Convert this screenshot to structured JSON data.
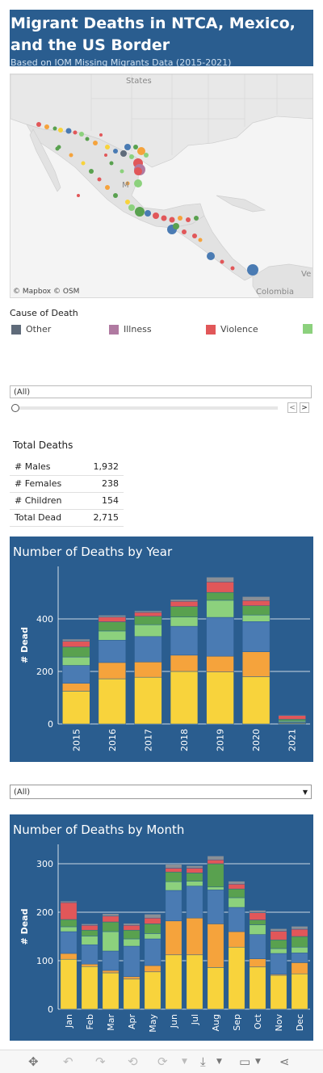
{
  "header": {
    "title": "Migrant Deaths in NTCA, Mexico, and the US Border",
    "subtitle": "Based on IOM Missing Migrants Data (2015-2021)"
  },
  "map": {
    "labels": {
      "states": "States",
      "colombia": "Colombia",
      "mexico_partial": "M",
      "ve_partial": "Ve"
    },
    "credit_mapbox": "© Mapbox",
    "credit_osm": "© OSM"
  },
  "legend": {
    "title": "Cause of Death",
    "items": [
      {
        "label": "Other",
        "color": "#5f6b7a"
      },
      {
        "label": "Illness",
        "color": "#b07aa1"
      },
      {
        "label": "Violence",
        "color": "#e15759"
      },
      {
        "label": "",
        "color": "#8cd17d"
      }
    ]
  },
  "year_filter": {
    "value": "(All)",
    "prev": "<",
    "next": ">"
  },
  "totals": {
    "title": "Total Deaths",
    "rows": [
      {
        "label": "# Males",
        "value": "1,932"
      },
      {
        "label": "# Females",
        "value": "238"
      },
      {
        "label": "# Children",
        "value": "154"
      },
      {
        "label": "Total Dead",
        "value": "2,715"
      }
    ]
  },
  "month_filter": {
    "value": "(All)"
  },
  "colors": {
    "panel_bg": "#2a5d8f",
    "yellow": "#f8d33c",
    "orange": "#f5a33c",
    "blue": "#4a7bb3",
    "lightgreen": "#8cd17d",
    "green": "#59a14f",
    "red": "#e15759",
    "grey": "#8a8f96"
  },
  "chart_data": [
    {
      "type": "bar",
      "stacked": true,
      "title": "Number of Deaths by Year",
      "ylabel": "# Dead",
      "ylim": [
        0,
        600
      ],
      "yticks": [
        0,
        200,
        400
      ],
      "categories": [
        "2015",
        "2016",
        "2017",
        "2018",
        "2019",
        "2020",
        "2021"
      ],
      "series": [
        {
          "color": "#f8d33c",
          "values": [
            125,
            172,
            178,
            200,
            198,
            180,
            3
          ]
        },
        {
          "color": "#f5a33c",
          "values": [
            30,
            62,
            58,
            62,
            60,
            95,
            2
          ]
        },
        {
          "color": "#4a7bb3",
          "values": [
            68,
            85,
            97,
            110,
            148,
            115,
            2
          ]
        },
        {
          "color": "#8cd17d",
          "values": [
            32,
            35,
            45,
            35,
            65,
            25,
            5
          ]
        },
        {
          "color": "#59a14f",
          "values": [
            38,
            35,
            32,
            40,
            30,
            35,
            6
          ]
        },
        {
          "color": "#e15759",
          "values": [
            22,
            18,
            15,
            20,
            40,
            20,
            14
          ]
        },
        {
          "color": "#8a8f96",
          "values": [
            8,
            7,
            6,
            7,
            18,
            15,
            3
          ]
        }
      ]
    },
    {
      "type": "bar",
      "stacked": true,
      "title": "Number of Deaths by Month",
      "ylabel": "# Dead",
      "ylim": [
        0,
        340
      ],
      "yticks": [
        0,
        100,
        200,
        300
      ],
      "categories": [
        "Jan",
        "Feb",
        "Mar",
        "Apr",
        "May",
        "Jun",
        "Jul",
        "Aug",
        "Sep",
        "Oct",
        "Nov",
        "Dec"
      ],
      "series": [
        {
          "color": "#f8d33c",
          "values": [
            103,
            88,
            75,
            62,
            77,
            112,
            112,
            86,
            128,
            87,
            70,
            73
          ]
        },
        {
          "color": "#f5a33c",
          "values": [
            12,
            5,
            5,
            5,
            13,
            70,
            76,
            90,
            32,
            17,
            2,
            23
          ]
        },
        {
          "color": "#4a7bb3",
          "values": [
            45,
            40,
            40,
            63,
            55,
            63,
            66,
            70,
            50,
            50,
            43,
            20
          ]
        },
        {
          "color": "#8cd17d",
          "values": [
            10,
            18,
            40,
            15,
            11,
            18,
            10,
            6,
            20,
            20,
            10,
            12
          ]
        },
        {
          "color": "#59a14f",
          "values": [
            15,
            12,
            20,
            18,
            20,
            20,
            17,
            48,
            18,
            10,
            18,
            22
          ]
        },
        {
          "color": "#e15759",
          "values": [
            35,
            10,
            12,
            10,
            12,
            8,
            10,
            8,
            10,
            15,
            18,
            15
          ]
        },
        {
          "color": "#8a8f96",
          "values": [
            3,
            3,
            5,
            4,
            8,
            8,
            5,
            8,
            6,
            5,
            5,
            6
          ]
        }
      ]
    }
  ],
  "toolbar": {
    "icons": [
      "move-icon",
      "undo-icon",
      "redo-icon",
      "revert-icon",
      "refresh-icon",
      "download-icon",
      "device-preview-icon",
      "share-icon"
    ]
  }
}
